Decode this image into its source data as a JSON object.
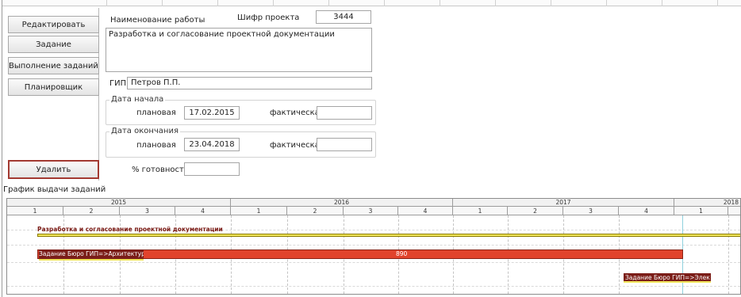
{
  "buttons": {
    "edit": "Редактировать",
    "task": "Задание",
    "task_execution": "Выполнение заданий",
    "planner": "Планировщик",
    "delete": "Удалить"
  },
  "form": {
    "work_name_label": "Наименование работы",
    "project_code_label": "Шифр проекта",
    "project_code_value": "3444",
    "description": "Разработка и согласование проектной документации",
    "gip_label": "ГИП",
    "gip_value": "Петров П.П.",
    "start_group_title": "Дата начала",
    "end_group_title": "Дата окончания",
    "planned_label": "плановая",
    "actual_label": "фактическая",
    "start_planned": "17.02.2015",
    "start_actual": "",
    "end_planned": "23.04.2018",
    "end_actual": "",
    "readiness_label": "% готовности",
    "readiness_value": ""
  },
  "gantt": {
    "title": "График выдачи заданий",
    "years": [
      "2015",
      "2016",
      "2017",
      "2018"
    ],
    "quarters": [
      "1",
      "2",
      "3",
      "4",
      "1",
      "2",
      "3",
      "4",
      "1",
      "2",
      "3",
      "4",
      "1"
    ],
    "project_label": "Разработка и согласование проектной документации",
    "tasks": [
      {
        "label": "Задание Бюро ГИП=>Архитектура",
        "value": "890"
      },
      {
        "label": "Задание Бюро ГИП=>Электр"
      }
    ]
  },
  "colors": {
    "project_bar": "#f0e55a",
    "task_bar": "#e1432c",
    "task_bar_dark": "#7b1d18",
    "today_line": "#8fd1de",
    "delete_border": "#a33a32"
  }
}
